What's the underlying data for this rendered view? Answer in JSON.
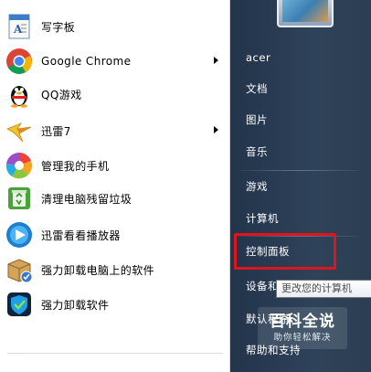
{
  "programs": [
    {
      "label": "写字板",
      "icon": "wordpad-icon",
      "has_submenu": false
    },
    {
      "label": "Google Chrome",
      "icon": "chrome-icon",
      "has_submenu": true
    },
    {
      "label": "QQ游戏",
      "icon": "qq-penguin-icon",
      "has_submenu": false
    },
    {
      "label": "迅雷7",
      "icon": "thunder-bird-icon",
      "has_submenu": true
    },
    {
      "label": "管理我的手机",
      "icon": "phone-manager-icon",
      "has_submenu": false
    },
    {
      "label": "清理电脑残留垃圾",
      "icon": "recycle-bin-icon",
      "has_submenu": false
    },
    {
      "label": "迅雷看看播放器",
      "icon": "xunlei-player-icon",
      "has_submenu": false
    },
    {
      "label": "强力卸载电脑上的软件",
      "icon": "uninstaller-box-icon",
      "has_submenu": false
    },
    {
      "label": "强力卸载软件",
      "icon": "shield-uninstall-icon",
      "has_submenu": false
    }
  ],
  "right_pane": {
    "user_name": "acer",
    "items": [
      "文档",
      "图片",
      "音乐",
      "游戏",
      "计算机",
      "控制面板",
      "设备和打印机",
      "默认程序",
      "帮助和支持"
    ]
  },
  "tooltip": "更改您的计算机",
  "watermark": {
    "title": "百科全说",
    "subtitle": "助你轻松解决"
  },
  "colors": {
    "highlight": "#e0141b",
    "right_pane": "#2b3d52"
  }
}
